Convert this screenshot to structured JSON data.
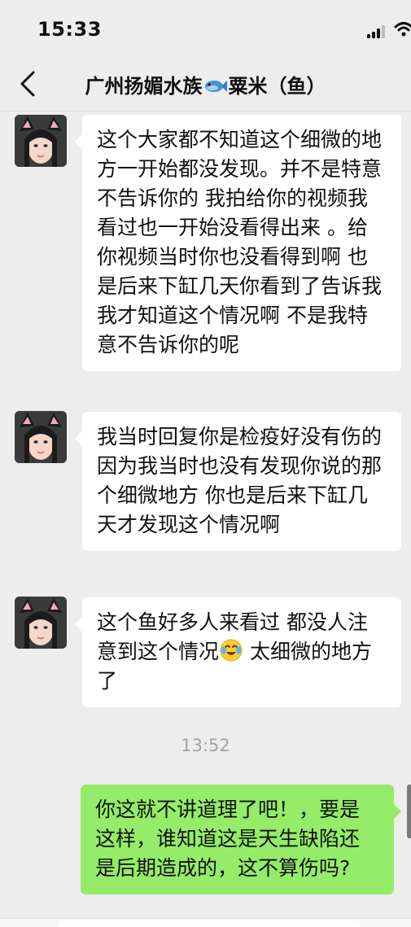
{
  "status_bar": {
    "time": "15:33"
  },
  "nav": {
    "title_prefix": "广州扬媚水族",
    "title_suffix": "粟米（鱼）"
  },
  "messages": [
    {
      "text": "这个大家都不知道这个细微的地方一开始都没发现。并不是特意不告诉你的 我拍给你的视频我看过也一开始没看得出来 。给你视频当时你也没看得到啊 也是后来下缸几天你看到了告诉我 我才知道这个情况啊 不是我特意不告诉你的呢"
    },
    {
      "text": "我当时回复你是检疫好没有伤的 因为我当时也没有发现你说的那个细微地方 你也是后来下缸几天才发现这个情况啊"
    },
    {
      "text_before": "这个鱼好多人来看过 都没人注意到这个情况",
      "text_after": " 太细微的地方了"
    }
  ],
  "timestamp": "13:52",
  "outgoing": {
    "text": "你这就不讲道理了吧！，要是这样，谁知道这是天生缺陷还是后期造成的，这不算伤吗?"
  },
  "colors": {
    "background": "#ededed",
    "incoming_bubble": "#ffffff",
    "outgoing_bubble": "#95ec69",
    "timestamp": "#a3a3a3"
  },
  "icons": [
    "back-chevron-icon",
    "fish-emoji-icon",
    "crying-laughing-emoji-icon",
    "signal-icon",
    "wifi-icon"
  ]
}
